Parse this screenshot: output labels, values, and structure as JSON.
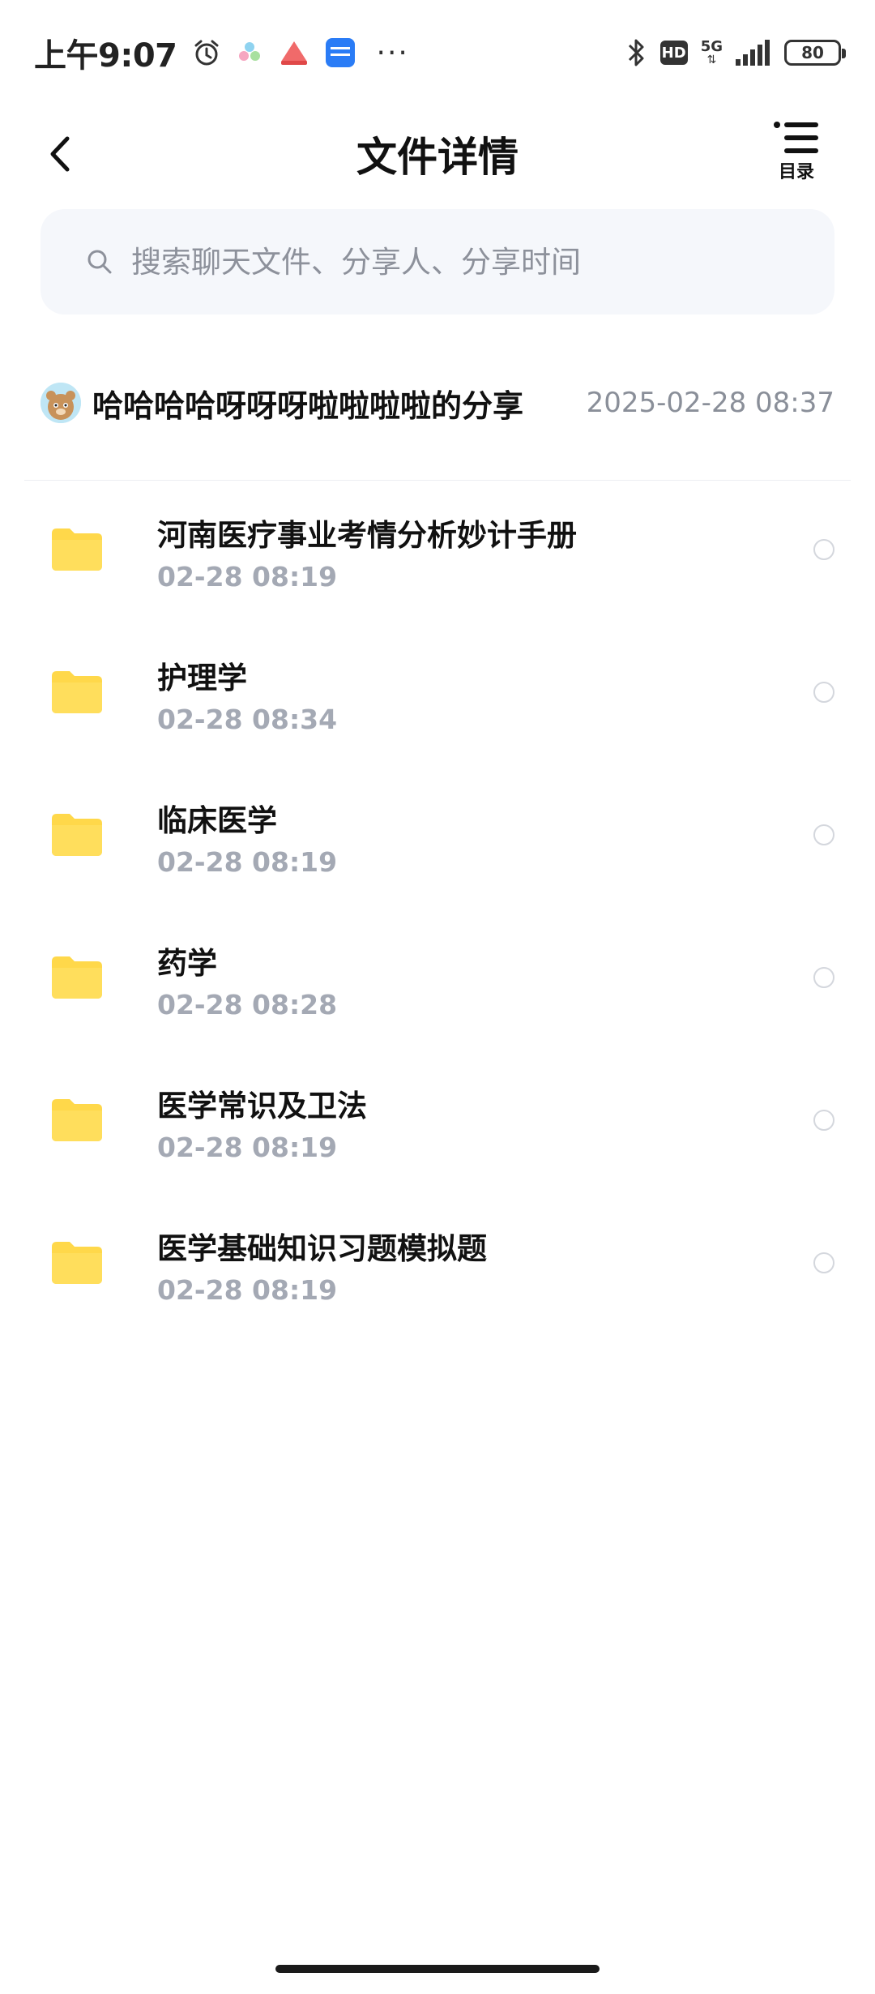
{
  "status_bar": {
    "time": "上午9:07",
    "app_icons": [
      "alarm-icon",
      "app-icon-1",
      "app-icon-2",
      "app-icon-3"
    ],
    "more": "···",
    "hd": "HD",
    "network": "5G",
    "battery": "80"
  },
  "header": {
    "title": "文件详情",
    "toc_label": "目录"
  },
  "search": {
    "placeholder": "搜索聊天文件、分享人、分享时间"
  },
  "share": {
    "sharer": "哈哈哈哈呀呀呀啦啦啦啦的分享",
    "time": "2025-02-28   08:37"
  },
  "files": [
    {
      "name": "河南医疗事业考情分析妙计手册",
      "time": "02-28   08:19"
    },
    {
      "name": "护理学",
      "time": "02-28   08:34"
    },
    {
      "name": "临床医学",
      "time": "02-28   08:19"
    },
    {
      "name": "药学",
      "time": "02-28   08:28"
    },
    {
      "name": "医学常识及卫法",
      "time": "02-28   08:19"
    },
    {
      "name": "医学基础知识习题模拟题",
      "time": "02-28   08:19"
    }
  ],
  "colors": {
    "folder": "#FFD84A",
    "secondary_text": "#A4A9B4",
    "search_bg": "#F5F7FB"
  }
}
